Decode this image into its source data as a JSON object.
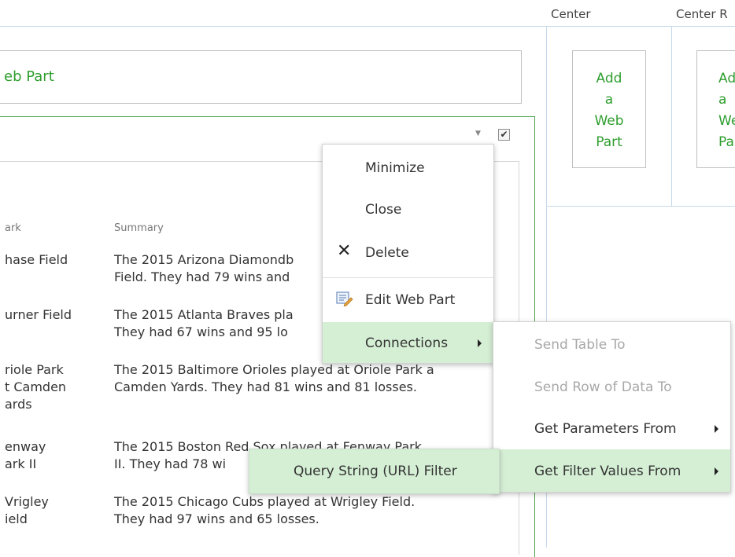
{
  "zones": {
    "center_label": "Center",
    "center_right_label": "Center R"
  },
  "left_zone": {
    "add_web_part_text": "eb Part"
  },
  "table": {
    "col_park": "ark",
    "col_summary": "Summary",
    "rows": [
      {
        "park": [
          "hase Field"
        ],
        "summary": [
          "The 2015 Arizona Diamondb",
          "Field. They had 79 wins and"
        ]
      },
      {
        "park": [
          "urner Field"
        ],
        "summary": [
          "The 2015 Atlanta Braves pla",
          "They had 67 wins and 95 lo"
        ]
      },
      {
        "park": [
          "riole Park",
          "t Camden",
          "ards"
        ],
        "summary": [
          "The 2015 Baltimore Orioles played at Oriole Park a",
          "Camden Yards. They had 81 wins and 81 losses."
        ]
      },
      {
        "park": [
          "enway",
          "ark II"
        ],
        "summary": [
          "The 2015 Boston Red Sox played at Fenway Park",
          "II. They had 78 wi"
        ]
      },
      {
        "park": [
          "Vrigley",
          "ield"
        ],
        "summary": [
          "The 2015 Chicago Cubs played at Wrigley Field.",
          "They had 97 wins and 65 losses."
        ]
      }
    ]
  },
  "center": {
    "box1": [
      "Add",
      "a",
      "Web",
      "Part"
    ],
    "box2": [
      "Ad",
      "a",
      "We",
      "Pa"
    ]
  },
  "webpart_menu": {
    "minimize": "Minimize",
    "close": "Close",
    "delete": "Delete",
    "edit": "Edit Web Part",
    "connections": "Connections"
  },
  "connections_menu": {
    "send_table": "Send Table To",
    "send_row": "Send Row of Data To",
    "get_params": "Get Parameters From",
    "get_filter": "Get Filter Values From"
  },
  "filter_menu": {
    "query_string": "Query String (URL) Filter"
  },
  "colors": {
    "link_green": "#2f9e2f",
    "highlight": "#d5efd5",
    "zone_border": "#c6d8ea"
  }
}
